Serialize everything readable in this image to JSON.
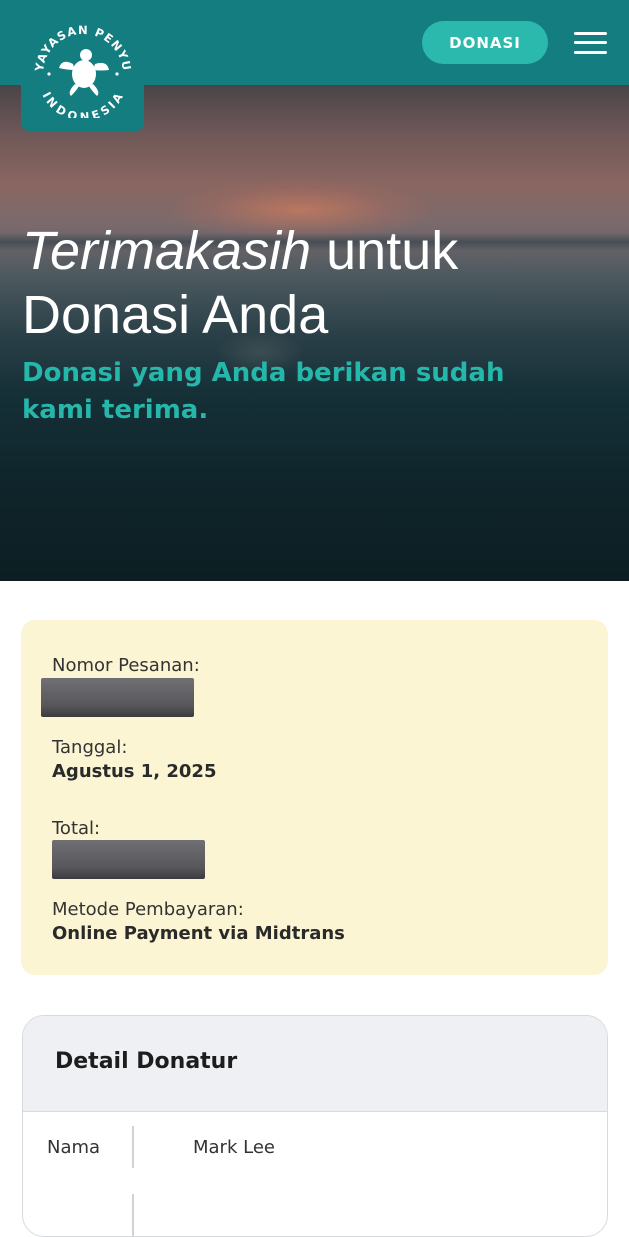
{
  "header": {
    "logo_text_top": "YAYASAN PENYU",
    "logo_text_bottom": "INDONESIA",
    "donate_label": "DONASI",
    "menu_icon": "hamburger-menu-icon",
    "colors": {
      "bar": "#137d80",
      "button": "#2bb8ad"
    }
  },
  "hero": {
    "title_italic": "Terimakasih",
    "title_rest_1": " untuk",
    "title_rest_2": "Donasi Anda",
    "subtitle": "Donasi yang Anda berikan sudah kami terima.",
    "subtitle_color": "#26b7ab"
  },
  "order": {
    "order_number_label": "Nomor Pesanan:",
    "date_label": "Tanggal:",
    "date_value": "Agustus 1, 2025",
    "total_label": "Total:",
    "payment_label": "Metode Pembayaran:",
    "payment_value": "Online Payment via Midtrans",
    "background": "#fbf5d3"
  },
  "donor": {
    "title": "Detail Donatur",
    "rows": [
      {
        "label": "Nama",
        "value": "Mark Lee"
      }
    ]
  }
}
